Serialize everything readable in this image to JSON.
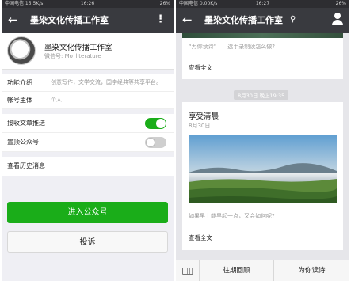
{
  "left": {
    "status": {
      "left": "中国电信 15.5K/s",
      "time": "16:26",
      "right": "26%"
    },
    "nav": {
      "back": "←",
      "title": "墨染文化传播工作室",
      "more": "⋮"
    },
    "profile": {
      "name": "墨染文化传播工作室",
      "wechat_id": "微信号: Mo_literature"
    },
    "info": [
      {
        "key": "功能介绍",
        "value": "创意写作，文学交流，国学经典等共享平台。"
      },
      {
        "key": "帐号主体",
        "value": "个人"
      }
    ],
    "settings": [
      {
        "label": "接收文章推送",
        "enabled": true
      },
      {
        "label": "置顶公众号",
        "enabled": false
      }
    ],
    "history": "查看历史消息",
    "enter_button": "进入公众号",
    "complain_button": "投诉"
  },
  "right": {
    "status": {
      "left": "中国电信 0.00K/s",
      "time": "16:27",
      "right": "26%"
    },
    "nav": {
      "back": "←",
      "title": "墨染文化传播工作室",
      "loc_icon": "⚲"
    },
    "card1": {
      "desc": "“为你读诗”——选手录制读怎么做?",
      "read_all": "查看全文"
    },
    "time_chip": "8月30日 晚上19:35",
    "card2": {
      "title": "享受清晨",
      "date": "8月30日",
      "question": "如果早上能早起一点，又会如何呢?",
      "read_all": "查看全文"
    },
    "bottom": {
      "menu1": "往期回顾",
      "menu2": "为你读诗"
    }
  }
}
